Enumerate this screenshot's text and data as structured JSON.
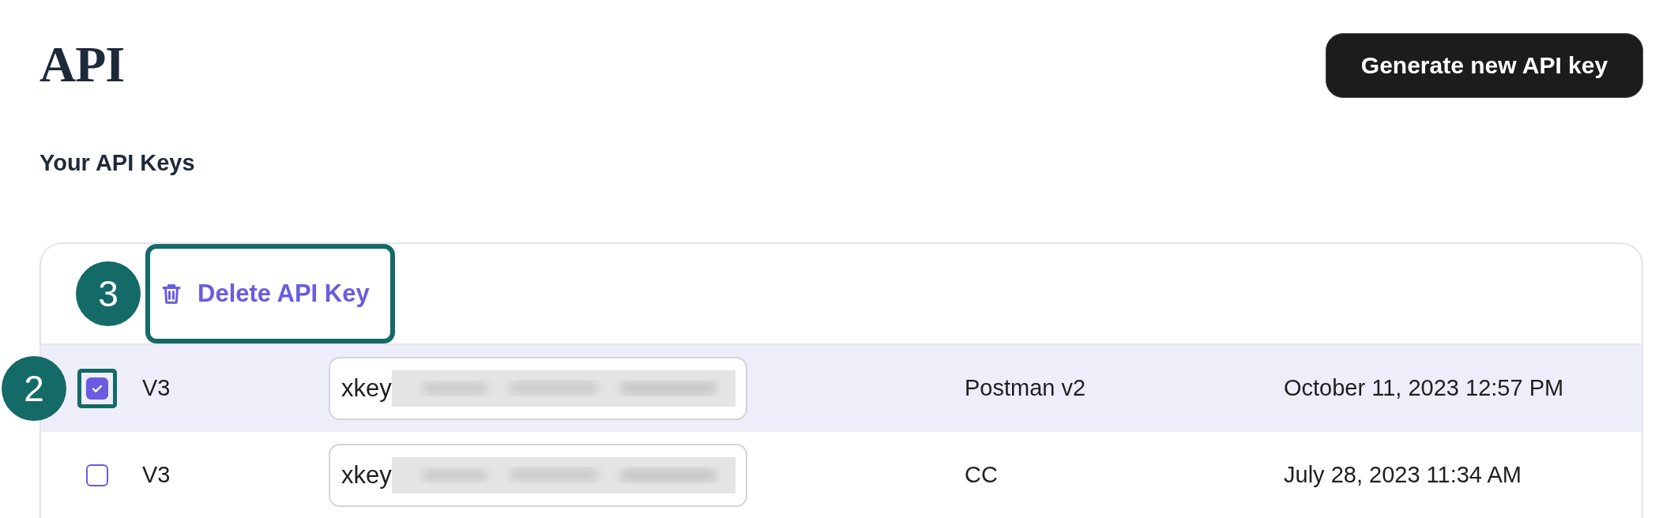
{
  "page_title": "API",
  "generate_button": "Generate new API key",
  "section_title": "Your API Keys",
  "delete_button": {
    "label": "Delete API Key",
    "annotation": "3"
  },
  "rows": [
    {
      "selected": true,
      "annotation": "2",
      "version": "V3",
      "key_prefix": "xkey",
      "name": "Postman v2",
      "created": "October 11, 2023 12:57 PM"
    },
    {
      "selected": false,
      "version": "V3",
      "key_prefix": "xkey",
      "name": "CC",
      "created": "July 28, 2023 11:34 AM"
    }
  ]
}
